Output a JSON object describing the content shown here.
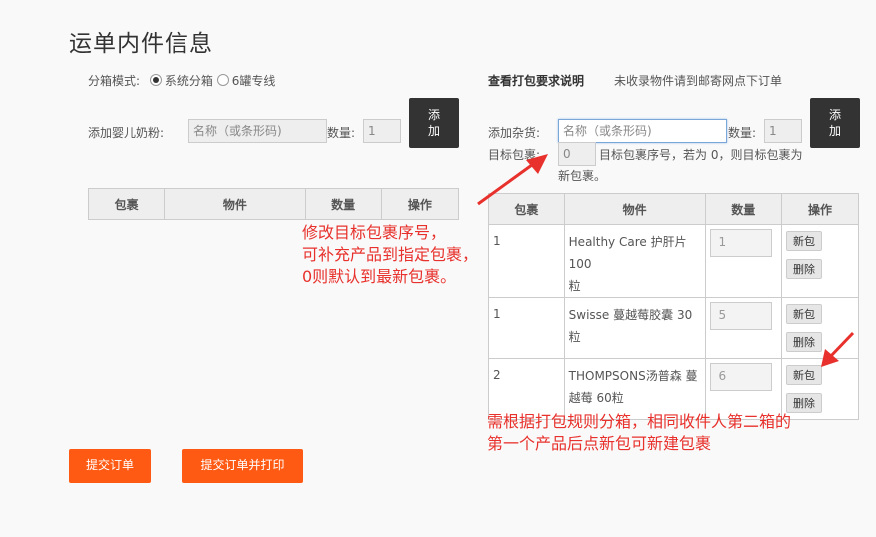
{
  "page_title": "运单内件信息",
  "left": {
    "mode_label": "分箱模式:",
    "mode_options": [
      {
        "label": "系统分箱",
        "selected": true
      },
      {
        "label": "6罐专线",
        "selected": false
      }
    ],
    "add_formula_label": "添加婴儿奶粉:",
    "name_placeholder": "名称（或条形码)",
    "qty_label": "数量:",
    "qty_value": "1",
    "add_button": "添\n加",
    "table_headers": [
      "包裹",
      "物件",
      "数量",
      "操作"
    ]
  },
  "right": {
    "pack_rules_link": "查看打包要求说明",
    "unlisted_note": "未收录物件请到邮寄网点下订单",
    "add_misc_label": "添加杂货:",
    "name_placeholder": "名称（或条形码)",
    "qty_label": "数量:",
    "qty_value": "1",
    "add_button": "添\n加",
    "target_label": "目标包裹:",
    "target_value": "0",
    "target_hint_1": "目标包裹序号，若为 0，则目标包裹为",
    "target_hint_2": "新包裹。",
    "table_headers": [
      "包裹",
      "物件",
      "数量",
      "操作"
    ],
    "rows": [
      {
        "pkg": "1",
        "item_line1": "Healthy Care 护肝片 100",
        "item_line2": "粒",
        "qty": "1",
        "new_btn": "新包",
        "del_btn": "删除"
      },
      {
        "pkg": "1",
        "item_line1": "Swisse 蔓越莓胶囊 30粒",
        "item_line2": "",
        "qty": "5",
        "new_btn": "新包",
        "del_btn": "删除"
      },
      {
        "pkg": "2",
        "item_line1": "THOMPSONS汤普森 蔓",
        "item_line2": "越莓 60粒",
        "qty": "6",
        "new_btn": "新包",
        "del_btn": "删除"
      }
    ]
  },
  "annotations": {
    "note1_line1": "修改目标包裹序号，",
    "note1_line2": "可补充产品到指定包裹，",
    "note1_line3": "0则默认到最新包裹。",
    "note2_line1": "需根据打包规则分箱，相同收件人第二箱的",
    "note2_line2": "第一个产品后点新包可新建包裹"
  },
  "buttons": {
    "submit": "提交订单",
    "submit_print": "提交订单并打印"
  },
  "colors": {
    "accent_orange": "#ff5a13",
    "annotation_red": "#e8312c",
    "dark_button": "#333333"
  }
}
